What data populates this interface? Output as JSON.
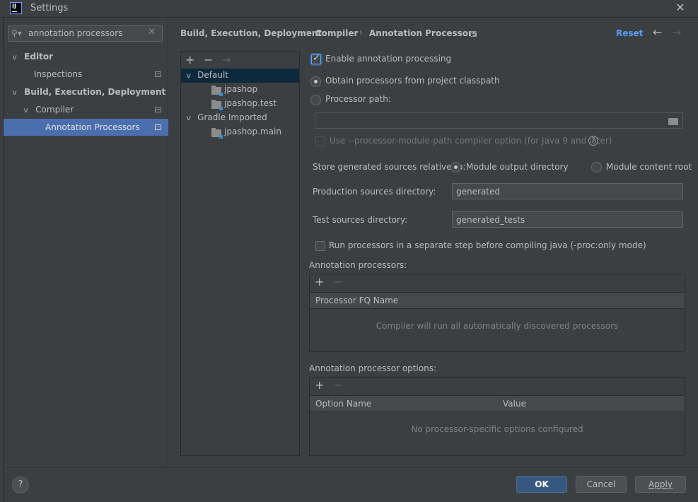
{
  "window": {
    "title": "Settings",
    "logo": "IJ"
  },
  "search": {
    "value": "annotation processors"
  },
  "sidebar": {
    "items": [
      {
        "label": "Editor"
      },
      {
        "label": "Inspections"
      },
      {
        "label": "Build, Execution, Deployment"
      },
      {
        "label": "Compiler"
      },
      {
        "label": "Annotation Processors"
      }
    ]
  },
  "breadcrumb": {
    "items": [
      "Build, Execution, Deployment",
      "Compiler",
      "Annotation Processors"
    ],
    "separator": "›",
    "reset": "Reset"
  },
  "modules": {
    "toolbar": {
      "add": "+",
      "remove": "−",
      "move": "→"
    },
    "items": [
      {
        "label": "Default"
      },
      {
        "label": "jpashop"
      },
      {
        "label": "jpashop.test"
      },
      {
        "label": "Gradle Imported"
      },
      {
        "label": "jpashop.main"
      }
    ]
  },
  "settings": {
    "enable_label": "Enable annotation processing",
    "obtain_label": "Obtain processors from project classpath",
    "processor_path_label": "Processor path:",
    "processor_path_value": "",
    "module_path_label": "Use --processor-module-path compiler option (for Java 9 and later)",
    "store_label": "Store generated sources relative to:",
    "module_output_label": "Module output directory",
    "module_content_label": "Module content root",
    "production_label": "Production sources directory:",
    "production_value": "generated",
    "test_label": "Test sources directory:",
    "test_value": "generated_tests",
    "run_separate_label": "Run processors in a separate step before compiling java (-proc:only mode)"
  },
  "annotation_processors": {
    "title": "Annotation processors:",
    "add": "+",
    "remove": "−",
    "column": "Processor FQ Name",
    "empty": "Compiler will run all automatically discovered processors"
  },
  "processor_options": {
    "title": "Annotation processor options:",
    "add": "+",
    "remove": "−",
    "columns": [
      "Option Name",
      "Value"
    ],
    "empty": "No processor-specific options configured"
  },
  "buttons": {
    "help": "?",
    "ok": "OK",
    "cancel": "Cancel",
    "apply": "Apply"
  },
  "colors": {
    "accent": "#4b6eaf",
    "link": "#589df6",
    "background": "#3c3f41"
  }
}
